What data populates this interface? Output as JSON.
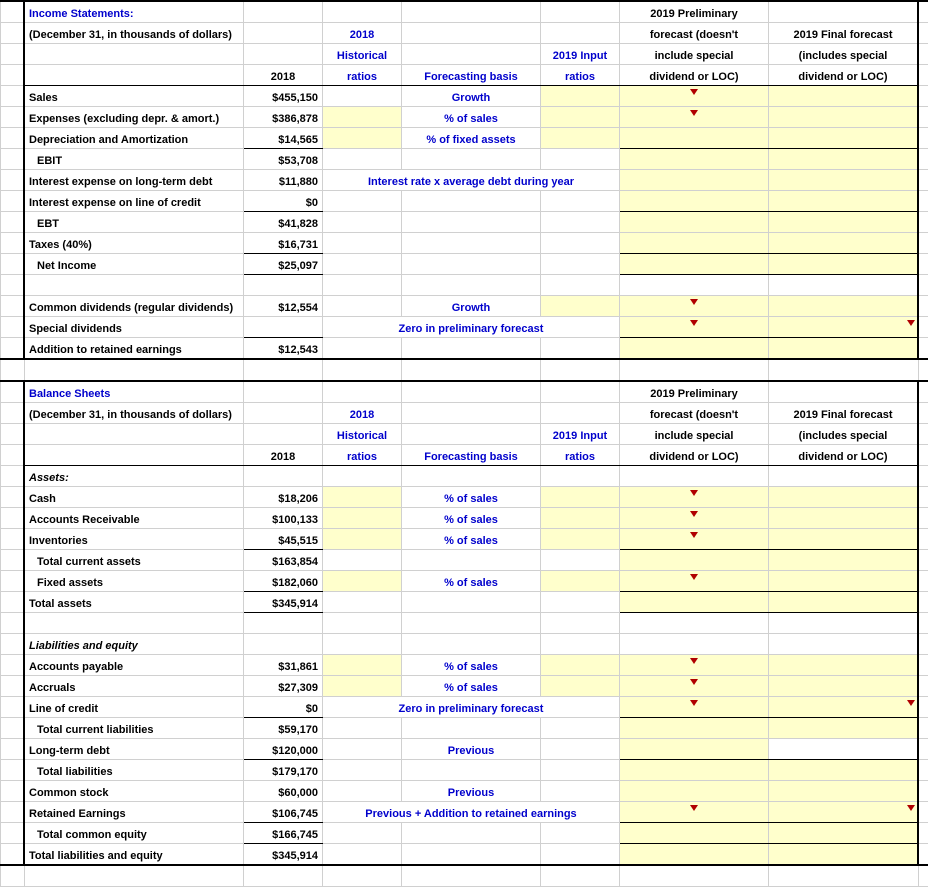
{
  "income": {
    "title": "Income Statements:",
    "subtitle": "(December 31, in thousands of dollars)",
    "headers": {
      "y2018": "2018",
      "hist": "2018\nHistorical\nratios",
      "basis": "Forecasting basis",
      "input": "2019 Input\nratios",
      "prelim": "2019 Preliminary\nforecast (doesn't\ninclude special\ndividend or LOC)",
      "final": "2019 Final forecast\n(includes special\ndividend or LOC)"
    },
    "rows": {
      "sales": {
        "label": "Sales",
        "v": "$455,150",
        "basis": "Growth"
      },
      "expenses": {
        "label": "Expenses (excluding depr. & amort.)",
        "v": "$386,878",
        "basis": "% of sales"
      },
      "depr": {
        "label": "Depreciation and Amortization",
        "v": "$14,565",
        "basis": "% of fixed assets"
      },
      "ebit": {
        "label": "EBIT",
        "v": "$53,708"
      },
      "int_lt": {
        "label": "Interest expense on long-term debt",
        "v": "$11,880",
        "note": "Interest rate x average debt during year"
      },
      "int_loc": {
        "label": "Interest expense on line of credit",
        "v": "$0"
      },
      "ebt": {
        "label": "EBT",
        "v": "$41,828"
      },
      "taxes": {
        "label": "Taxes (40%)",
        "v": "$16,731"
      },
      "ni": {
        "label": "Net Income",
        "v": "$25,097"
      },
      "div_common": {
        "label": "Common dividends (regular dividends)",
        "v": "$12,554",
        "basis": "Growth"
      },
      "div_special": {
        "label": "Special dividends",
        "note": "Zero in preliminary forecast"
      },
      "add_re": {
        "label": "Addition to retained earnings",
        "v": "$12,543"
      }
    }
  },
  "balance": {
    "title": "Balance Sheets",
    "subtitle": "(December 31, in thousands of dollars)",
    "assets_hdr": "Assets:",
    "liab_hdr": "Liabilities and equity",
    "rows": {
      "cash": {
        "label": "Cash",
        "v": "$18,206",
        "basis": "% of sales"
      },
      "ar": {
        "label": "Accounts Receivable",
        "v": "$100,133",
        "basis": "% of sales"
      },
      "inv": {
        "label": "Inventories",
        "v": "$45,515",
        "basis": "% of sales"
      },
      "tca": {
        "label": "Total current assets",
        "v": "$163,854"
      },
      "fa": {
        "label": "Fixed assets",
        "v": "$182,060",
        "basis": "% of sales"
      },
      "ta": {
        "label": "Total assets",
        "v": "$345,914"
      },
      "ap": {
        "label": "Accounts payable",
        "v": "$31,861",
        "basis": "% of sales"
      },
      "accruals": {
        "label": "Accruals",
        "v": "$27,309",
        "basis": "% of sales"
      },
      "loc": {
        "label": "Line of credit",
        "v": "$0",
        "note": "Zero in preliminary forecast"
      },
      "tcl": {
        "label": "Total current liabilities",
        "v": "$59,170"
      },
      "ltd": {
        "label": "Long-term debt",
        "v": "$120,000",
        "basis": "Previous"
      },
      "tl": {
        "label": "Total liabilities",
        "v": "$179,170"
      },
      "cs": {
        "label": "Common stock",
        "v": "$60,000",
        "basis": "Previous"
      },
      "re": {
        "label": "Retained Earnings",
        "v": "$106,745",
        "note": "Previous + Addition to retained earnings"
      },
      "tce": {
        "label": "Total common equity",
        "v": "$166,745"
      },
      "tle": {
        "label": "Total liabilities and equity",
        "v": "$345,914"
      }
    }
  },
  "hdr": {
    "y2018": "2018",
    "hist1": "2018",
    "hist2": "Historical",
    "hist3": "ratios",
    "basis": "Forecasting basis",
    "input1": "2019 Input",
    "input2": "ratios",
    "prelim1": "2019 Preliminary",
    "prelim2": "forecast (doesn't",
    "prelim3": "include special",
    "prelim4": "dividend or LOC)",
    "final1": "2019 Final forecast",
    "final2": "(includes special",
    "final3": "dividend or LOC)"
  }
}
